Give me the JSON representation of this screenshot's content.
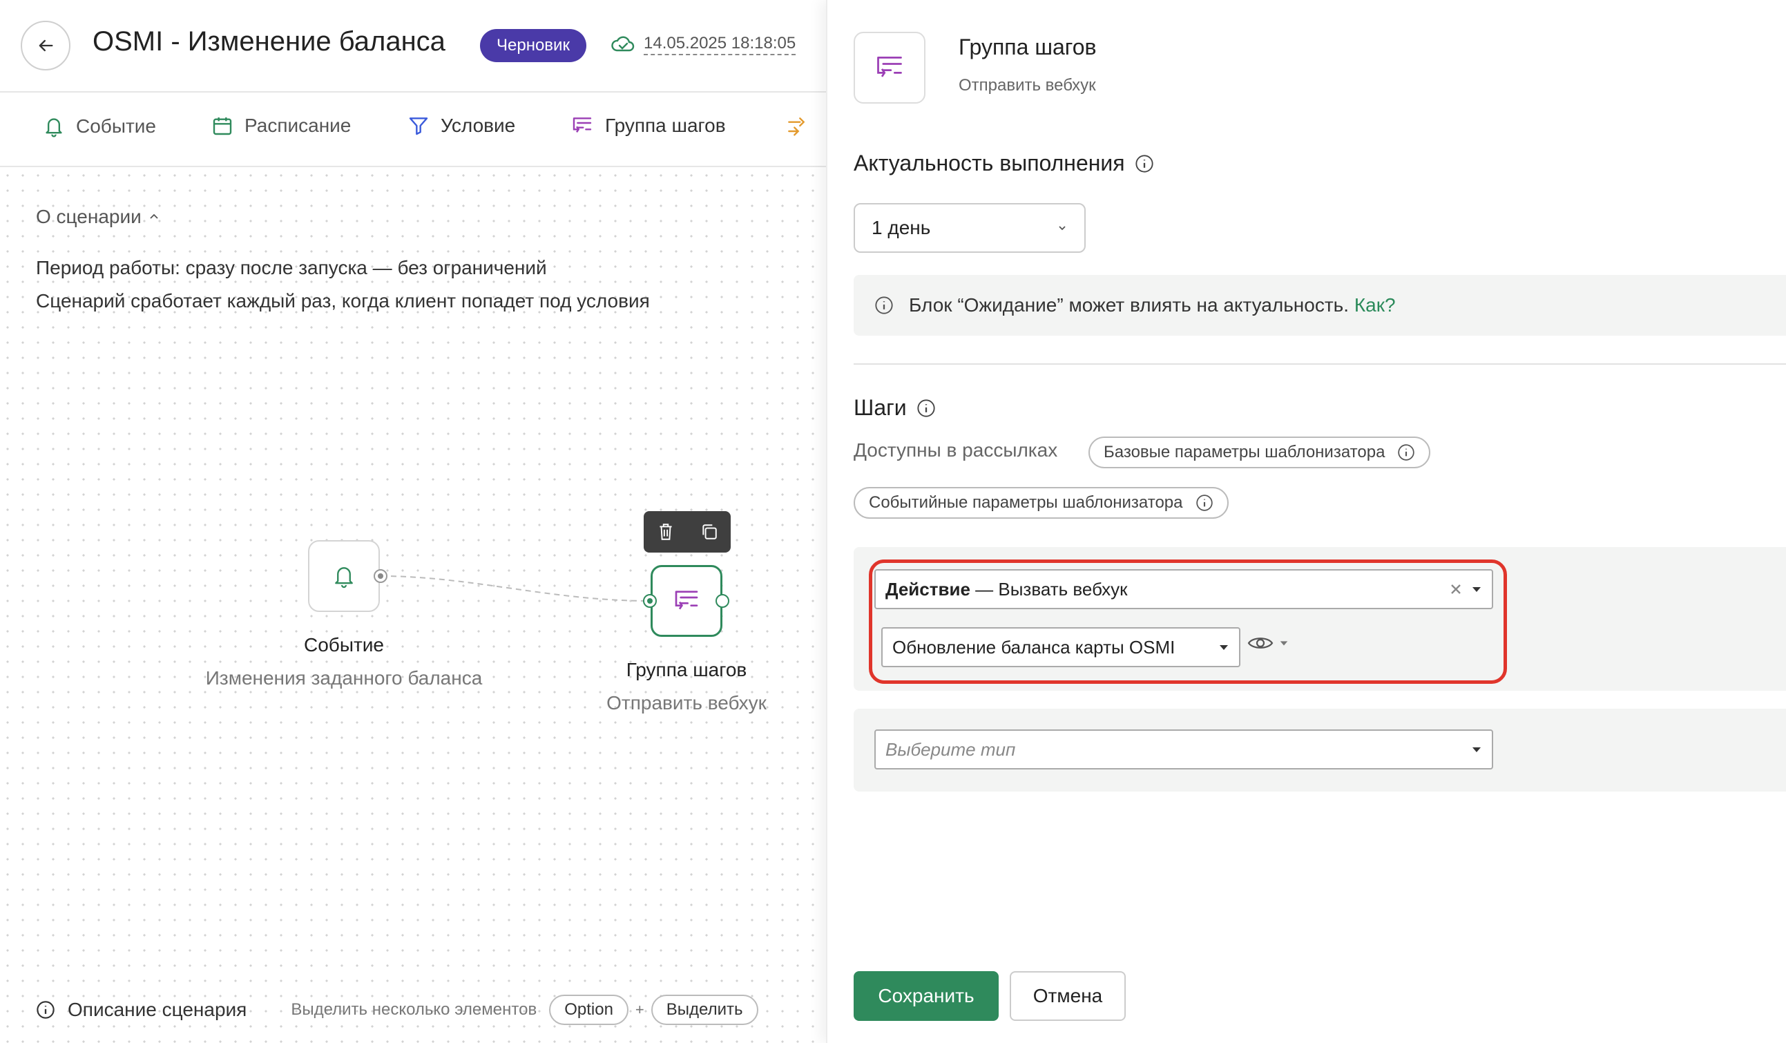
{
  "header": {
    "title": "OSMI - Изменение баланса",
    "status_badge": "Черновик",
    "saved_at": "14.05.2025 18:18:05"
  },
  "toolbar": {
    "items": [
      {
        "label": "Событие",
        "icon": "bell-icon"
      },
      {
        "label": "Расписание",
        "icon": "calendar-icon"
      },
      {
        "label": "Условие",
        "icon": "filter-icon"
      },
      {
        "label": "Группа шагов",
        "icon": "step-group-icon"
      },
      {
        "label": "",
        "icon": "branch-icon"
      }
    ]
  },
  "scenario": {
    "about_label": "О сценарии",
    "period": "Период работы: сразу после запуска — без ограничений",
    "trigger_note": "Сценарий сработает каждый раз, когда клиент попадет под условия"
  },
  "canvas": {
    "nodes": [
      {
        "title": "Событие",
        "subtitle": "Изменения заданного баланса",
        "icon": "bell-icon"
      },
      {
        "title": "Группа шагов",
        "subtitle": "Отправить вебхук",
        "icon": "step-group-icon"
      }
    ]
  },
  "footer": {
    "description_label": "Описание сценария",
    "multi_select_hint": "Выделить несколько элементов",
    "key_option": "Option",
    "plus": "+",
    "key_select": "Выделить"
  },
  "panel": {
    "block_title": "Группа шагов",
    "block_subtitle": "Отправить вебхук",
    "relevance_title": "Актуальность выполнения",
    "relevance_value": "1 день",
    "notice_text": "Блок “Ожидание” может влиять на актуальность.",
    "notice_link": "Как?",
    "steps_title": "Шаги",
    "available_label": "Доступны в рассылках",
    "chips": [
      "Базовые параметры шаблонизатора",
      "Событийные параметры шаблонизатора"
    ],
    "action_label": "Действие",
    "action_value": "— Вызвать вебхук",
    "webhook_value": "Обновление баланса карты OSMI",
    "type_placeholder": "Выберите тип",
    "save_button": "Сохранить",
    "cancel_button": "Отмена"
  },
  "colors": {
    "accent_green": "#2f8a5c",
    "badge_purple": "#4a3aa8",
    "highlight_red": "#e0352b",
    "step_icon_purple": "#9b3fb5",
    "branch_orange": "#e39a2d"
  }
}
